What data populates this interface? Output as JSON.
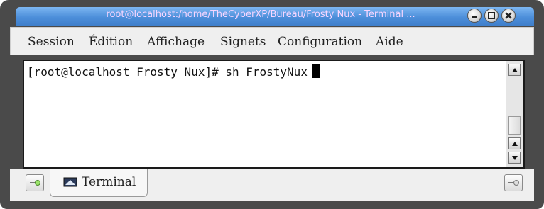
{
  "window": {
    "title": "root@localhost:/home/TheCyberXP/Bureau/Frosty Nux - Terminal ..."
  },
  "menubar": {
    "items": [
      "Session",
      "Édition",
      "Affichage",
      "Signets",
      "Configuration",
      "Aide"
    ]
  },
  "terminal": {
    "line": "[root@localhost Frosty Nux]# sh FrostyNux"
  },
  "tabs": [
    {
      "label": "Terminal"
    }
  ],
  "colors": {
    "titlebar": "#4d8fda",
    "title_text": "#f7d6ff",
    "frame": "#4a4a4a",
    "menubar": "#efefef"
  },
  "icons": [
    "minimize-icon",
    "maximize-icon",
    "close-icon",
    "scroll-up-icon",
    "scroll-down-icon",
    "new-tab-icon",
    "close-tab-icon",
    "terminal-tab-icon"
  ]
}
